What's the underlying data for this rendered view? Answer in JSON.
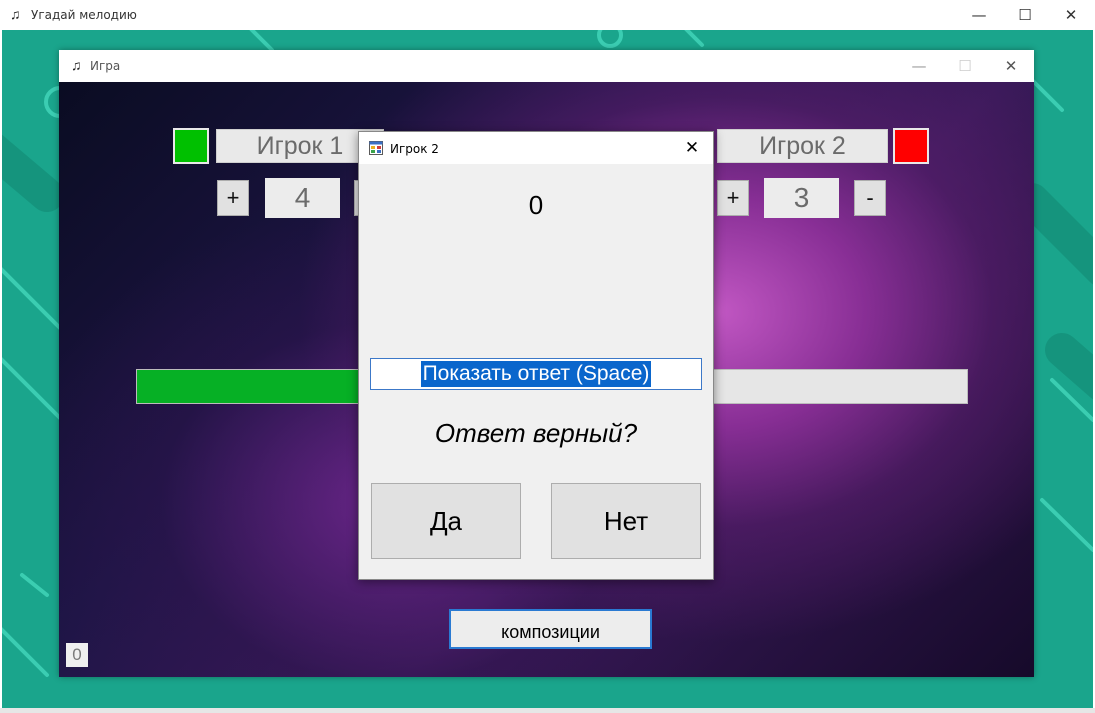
{
  "outer_window": {
    "title": "Угадай мелодию",
    "icon": "music-note-icon",
    "controls": {
      "minimize": "—",
      "maximize": "☐",
      "close": "✕"
    }
  },
  "game_window": {
    "title": "Игра",
    "icon": "music-note-icon",
    "controls": {
      "minimize": "—",
      "maximize": "☐",
      "close": "✕"
    }
  },
  "player1": {
    "name": "Игрок 1",
    "color": "#00c000",
    "score": "4",
    "plus": "+",
    "progress": 0.3
  },
  "player2": {
    "name": "Игрок 2",
    "color": "#ff0000",
    "score": "3",
    "plus": "+",
    "minus": "-"
  },
  "counter": "0",
  "compose_button": "композиции",
  "dialog": {
    "title": "Игрок 2",
    "icon": "app-form-icon",
    "value": "0",
    "reveal_button": "Показать ответ (Space)",
    "question": "Ответ верный?",
    "yes_button": "Да",
    "no_button": "Нет",
    "close": "✕"
  },
  "colors": {
    "outer_background": "#1aa58c",
    "selection": "#0a66cc"
  }
}
